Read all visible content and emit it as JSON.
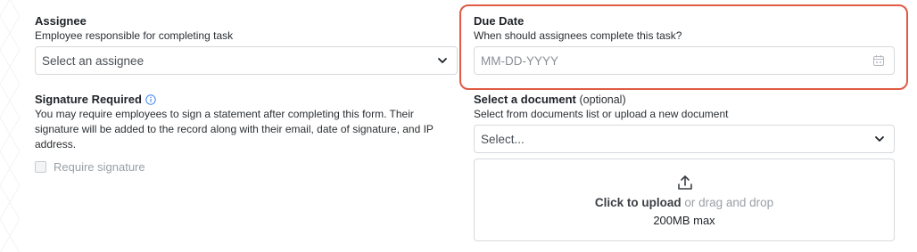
{
  "assignee": {
    "label": "Assignee",
    "help": "Employee responsible for completing task",
    "placeholder": "Select an assignee"
  },
  "due_date": {
    "label": "Due Date",
    "help": "When should assignees complete this task?",
    "placeholder": "MM-DD-YYYY"
  },
  "signature": {
    "label": "Signature Required",
    "help": "You may require employees to sign a statement after completing this form. Their signature will be added to the record along with their email, date of signature, and IP address.",
    "checkbox_label": "Require signature"
  },
  "document": {
    "label": "Select a document",
    "optional": "(optional)",
    "help": "Select from documents list or upload a new document",
    "placeholder": "Select...",
    "upload_strong": "Click to upload",
    "upload_rest": " or drag and drop",
    "size_limit": "200MB max"
  },
  "colors": {
    "highlight": "#e05a45",
    "info": "#3b82f6"
  },
  "icons": [
    "chevron-down-icon",
    "calendar-icon",
    "info-icon",
    "upload-icon"
  ]
}
